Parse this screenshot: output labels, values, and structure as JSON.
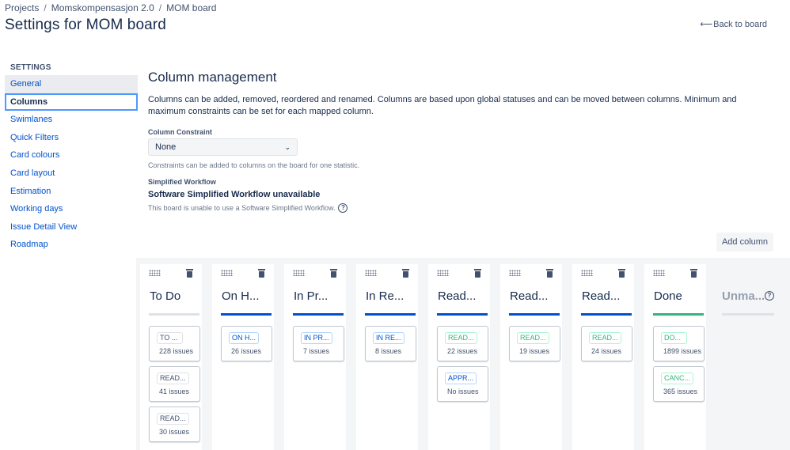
{
  "breadcrumb": [
    "Projects",
    "Momskompensasjon 2.0",
    "MOM board"
  ],
  "page_title": "Settings for MOM board",
  "back_link": "Back to board",
  "sidebar": {
    "heading": "SETTINGS",
    "items": [
      {
        "label": "General",
        "state": "hover"
      },
      {
        "label": "Columns",
        "state": "active"
      },
      {
        "label": "Swimlanes",
        "state": ""
      },
      {
        "label": "Quick Filters",
        "state": ""
      },
      {
        "label": "Card colours",
        "state": ""
      },
      {
        "label": "Card layout",
        "state": ""
      },
      {
        "label": "Estimation",
        "state": ""
      },
      {
        "label": "Working days",
        "state": ""
      },
      {
        "label": "Issue Detail View",
        "state": ""
      },
      {
        "label": "Roadmap",
        "state": ""
      }
    ]
  },
  "main": {
    "title": "Column management",
    "description": "Columns can be added, removed, reordered and renamed. Columns are based upon global statuses and can be moved between columns. Minimum and maximum constraints can be set for each mapped column.",
    "constraint_label": "Column Constraint",
    "constraint_value": "None",
    "constraint_help": "Constraints can be added to columns on the board for one statistic.",
    "workflow_label": "Simplified Workflow",
    "workflow_title": "Software Simplified Workflow unavailable",
    "workflow_note": "This board is unable to use a Software Simplified Workflow.",
    "add_column": "Add column"
  },
  "colors": {
    "todo_bar": "#DFE1E6",
    "progress_bar": "#0052CC",
    "done_bar": "#36B37E",
    "todo_pill": "#42526E",
    "progress_pill": "#0052CC",
    "done_pill": "#36B37E"
  },
  "columns": [
    {
      "name": "To Do",
      "category": "todo",
      "statuses": [
        {
          "label": "TO ...",
          "count": "228 issues"
        },
        {
          "label": "READ...",
          "count": "41 issues"
        },
        {
          "label": "READ...",
          "count": "30 issues"
        }
      ]
    },
    {
      "name": "On H...",
      "category": "progress",
      "statuses": [
        {
          "label": "ON H...",
          "count": "26 issues"
        }
      ]
    },
    {
      "name": "In Pr...",
      "category": "progress",
      "statuses": [
        {
          "label": "IN PR...",
          "count": "7 issues"
        }
      ]
    },
    {
      "name": "In Re...",
      "category": "progress",
      "statuses": [
        {
          "label": "IN RE...",
          "count": "8 issues"
        }
      ]
    },
    {
      "name": "Read...",
      "category": "progress",
      "statuses": [
        {
          "label": "READ...",
          "count": "22 issues",
          "pill": "done"
        },
        {
          "label": "APPR...",
          "count": "No issues",
          "pill": "progress"
        }
      ]
    },
    {
      "name": "Read...",
      "category": "progress",
      "statuses": [
        {
          "label": "READ...",
          "count": "19 issues",
          "pill": "done"
        }
      ]
    },
    {
      "name": "Read...",
      "category": "progress",
      "statuses": [
        {
          "label": "READ...",
          "count": "24 issues",
          "pill": "done"
        }
      ]
    },
    {
      "name": "Done",
      "category": "done",
      "statuses": [
        {
          "label": "DO...",
          "count": "1899 issues",
          "pill": "done"
        },
        {
          "label": "CANC...",
          "count": "365 issues",
          "pill": "done"
        }
      ]
    }
  ],
  "unmapped": {
    "name": "Unma...",
    "icon": "question-icon"
  }
}
